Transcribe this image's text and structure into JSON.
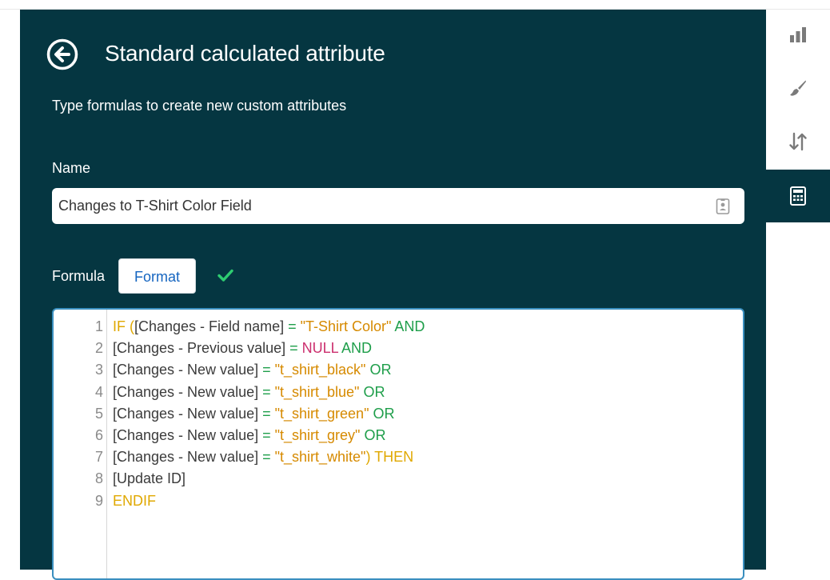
{
  "panel": {
    "title": "Standard calculated attribute",
    "subtitle": "Type formulas to create new custom attributes",
    "back_icon": "circle-arrow-left-icon"
  },
  "name_field": {
    "label": "Name",
    "value": "Changes to T-Shirt Color Field",
    "icon": "contact-card-icon"
  },
  "formula": {
    "label": "Formula",
    "format_button": "Format",
    "valid_icon": "checkmark-icon",
    "lines": [
      {
        "no": "1",
        "tokens": [
          {
            "t": "IF (",
            "c": "kw-yellow"
          },
          {
            "t": "[Changes - Field name]",
            "c": "ref"
          },
          {
            "t": " = ",
            "c": "kw-green"
          },
          {
            "t": "\"T-Shirt Color\"",
            "c": "str"
          },
          {
            "t": " AND",
            "c": "kw-green"
          }
        ]
      },
      {
        "no": "2",
        "tokens": [
          {
            "t": "[Changes - Previous value]",
            "c": "ref"
          },
          {
            "t": " = ",
            "c": "kw-green"
          },
          {
            "t": "NULL",
            "c": "null"
          },
          {
            "t": " AND",
            "c": "kw-green"
          }
        ]
      },
      {
        "no": "3",
        "tokens": [
          {
            "t": "[Changes - New value]",
            "c": "ref"
          },
          {
            "t": " = ",
            "c": "kw-green"
          },
          {
            "t": "\"t_shirt_black\"",
            "c": "str"
          },
          {
            "t": " OR",
            "c": "kw-green"
          }
        ]
      },
      {
        "no": "4",
        "tokens": [
          {
            "t": "[Changes - New value]",
            "c": "ref"
          },
          {
            "t": " = ",
            "c": "kw-green"
          },
          {
            "t": "\"t_shirt_blue\"",
            "c": "str"
          },
          {
            "t": " OR",
            "c": "kw-green"
          }
        ]
      },
      {
        "no": "5",
        "tokens": [
          {
            "t": "[Changes - New value]",
            "c": "ref"
          },
          {
            "t": " = ",
            "c": "kw-green"
          },
          {
            "t": "\"t_shirt_green\"",
            "c": "str"
          },
          {
            "t": " OR",
            "c": "kw-green"
          }
        ]
      },
      {
        "no": "6",
        "tokens": [
          {
            "t": "[Changes - New value]",
            "c": "ref"
          },
          {
            "t": " = ",
            "c": "kw-green"
          },
          {
            "t": "\"t_shirt_grey\"",
            "c": "str"
          },
          {
            "t": " OR",
            "c": "kw-green"
          }
        ]
      },
      {
        "no": "7",
        "tokens": [
          {
            "t": "[Changes - New value]",
            "c": "ref"
          },
          {
            "t": " = ",
            "c": "kw-green"
          },
          {
            "t": "\"t_shirt_white\"",
            "c": "str"
          },
          {
            "t": ") THEN",
            "c": "kw-yellow"
          }
        ]
      },
      {
        "no": "8",
        "tokens": [
          {
            "t": "[Update ID]",
            "c": "ref"
          }
        ]
      },
      {
        "no": "9",
        "tokens": [
          {
            "t": "ENDIF",
            "c": "kw-yellow"
          }
        ]
      }
    ]
  },
  "rail": {
    "items": [
      {
        "icon": "bar-chart-icon",
        "active": false
      },
      {
        "icon": "paintbrush-icon",
        "active": false
      },
      {
        "icon": "sort-arrows-icon",
        "active": false
      },
      {
        "icon": "calculator-icon",
        "active": true
      }
    ]
  },
  "colors": {
    "panel_bg": "#053641",
    "editor_border": "#3a8fbf",
    "keyword_yellow": "#e0a800",
    "keyword_green": "#1e9e4a",
    "string": "#d68a00",
    "null": "#cc2f6e",
    "check": "#2ecc71"
  }
}
